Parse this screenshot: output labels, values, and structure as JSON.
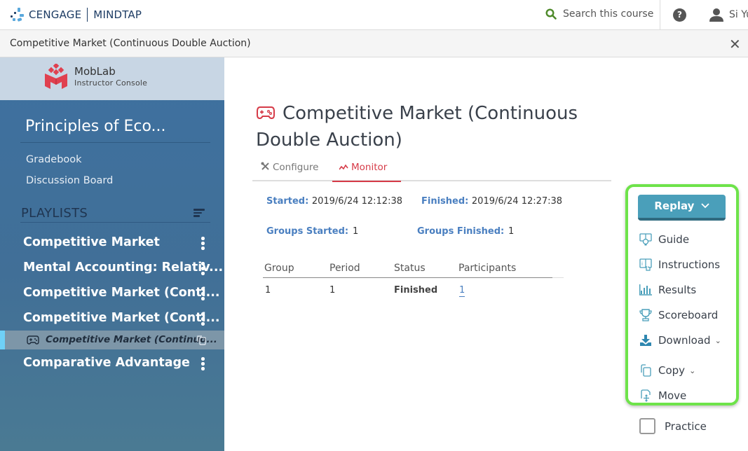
{
  "topbar": {
    "brand_left": "CENGAGE",
    "brand_right": "MINDTAP",
    "search_label": "Search this course",
    "help_icon": "question-circle-icon",
    "user_name": "Si Yu"
  },
  "titlebar": {
    "title": "Competitive Market (Continuous Double Auction)",
    "close_icon": "close-icon"
  },
  "sidebar": {
    "app_name": "MobLab",
    "app_subtitle": "Instructor Console",
    "course_title": "Principles of Eco...",
    "links": [
      "Gradebook",
      "Discussion Board"
    ],
    "playlists_label": "PLAYLISTS",
    "playlists": [
      {
        "label": "Competitive Market"
      },
      {
        "label": "Mental Accounting: Relativ..."
      },
      {
        "label": "Competitive Market (Conti..."
      },
      {
        "label": "Competitive Market (Conti..."
      },
      {
        "label": "Comparative Advantage"
      }
    ],
    "active_game": "Competitive Market (Continuo...",
    "accent_color": "#6fd0f6"
  },
  "main": {
    "title": "Competitive Market (Continuous Double Auction)",
    "tabs": [
      {
        "label": "Configure",
        "icon": "tools-icon",
        "active": false
      },
      {
        "label": "Monitor",
        "icon": "pulse-icon",
        "active": true
      }
    ],
    "started_label": "Started:",
    "started_value": "2019/6/24 12:12:38",
    "finished_label": "Finished:",
    "finished_value": "2019/6/24 12:27:38",
    "groups_started_label": "Groups Started:",
    "groups_started_value": "1",
    "groups_finished_label": "Groups Finished:",
    "groups_finished_value": "1",
    "table": {
      "headers": [
        "Group",
        "Period",
        "Status",
        "Participants"
      ],
      "rows": [
        {
          "group": "1",
          "period": "1",
          "status": "Finished",
          "participants": "1"
        }
      ]
    }
  },
  "actions": {
    "replay_label": "Replay",
    "items": [
      {
        "label": "Guide",
        "icon": "guide-icon"
      },
      {
        "label": "Instructions",
        "icon": "instructions-icon"
      },
      {
        "label": "Results",
        "icon": "bar-chart-icon"
      },
      {
        "label": "Scoreboard",
        "icon": "trophy-icon"
      },
      {
        "label": "Download",
        "icon": "download-icon"
      },
      {
        "label": "Copy",
        "icon": "copy-icon"
      },
      {
        "label": "Move",
        "icon": "move-icon"
      }
    ],
    "practice_label": "Practice",
    "practice_checked": false,
    "highlight_color": "#6ee34a",
    "button_color": "#4a9fba"
  }
}
